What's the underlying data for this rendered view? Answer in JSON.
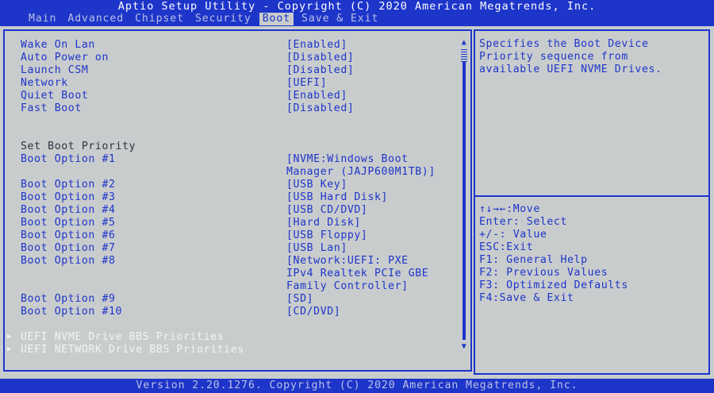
{
  "header": {
    "title": "Aptio Setup Utility - Copyright (C) 2020 American Megatrends, Inc.",
    "tabs": [
      {
        "label": "Main"
      },
      {
        "label": "Advanced"
      },
      {
        "label": "Chipset"
      },
      {
        "label": "Security"
      },
      {
        "label": "Boot"
      },
      {
        "label": "Save & Exit"
      }
    ],
    "active_tab": "Boot"
  },
  "settings": [
    {
      "label": "Wake On Lan",
      "value": "[Enabled]"
    },
    {
      "label": "Auto Power on",
      "value": "[Disabled]"
    },
    {
      "label": "Launch CSM",
      "value": "[Disabled]"
    },
    {
      "label": "Network",
      "value": "[UEFI]"
    },
    {
      "label": "Quiet Boot",
      "value": "[Enabled]"
    },
    {
      "label": "Fast Boot",
      "value": "[Disabled]"
    }
  ],
  "boot_priority": {
    "heading": "Set Boot Priority",
    "options": [
      {
        "label": "Boot Option #1",
        "value": [
          "[NVME:Windows Boot",
          "Manager (JAJP600M1TB)]"
        ]
      },
      {
        "label": "Boot Option #2",
        "value": [
          "[USB Key]"
        ]
      },
      {
        "label": "Boot Option #3",
        "value": [
          "[USB Hard Disk]"
        ]
      },
      {
        "label": "Boot Option #4",
        "value": [
          "[USB CD/DVD]"
        ]
      },
      {
        "label": "Boot Option #5",
        "value": [
          "[Hard Disk]"
        ]
      },
      {
        "label": "Boot Option #6",
        "value": [
          "[USB Floppy]"
        ]
      },
      {
        "label": "Boot Option #7",
        "value": [
          "[USB Lan]"
        ]
      },
      {
        "label": "Boot Option #8",
        "value": [
          "[Network:UEFI: PXE",
          "IPv4 Realtek PCIe GBE",
          "Family Controller]"
        ]
      },
      {
        "label": "Boot Option #9",
        "value": [
          "[SD]"
        ]
      },
      {
        "label": "Boot Option #10",
        "value": [
          "[CD/DVD]"
        ]
      }
    ]
  },
  "submenus": [
    {
      "label": "UEFI NVME Drive BBS Priorities"
    },
    {
      "label": "UEFI NETWORK Drive BBS Priorities"
    }
  ],
  "help": {
    "lines": [
      "Specifies the Boot Device",
      "Priority sequence from",
      "available UEFI NVME Drives."
    ]
  },
  "keys": [
    "↑↓→←:Move",
    "Enter: Select",
    "+/-: Value",
    "ESC:Exit",
    "F1: General Help",
    "F2: Previous Values",
    "F3: Optimized Defaults",
    "F4:Save & Exit"
  ],
  "footer": "Version 2.20.1276. Copyright (C) 2020 American Megatrends, Inc.",
  "colors": {
    "accent": "#1d35c9",
    "background": "#c9cccd",
    "highlight_text": "#f2f3f5",
    "heading_text": "#2b3340"
  }
}
